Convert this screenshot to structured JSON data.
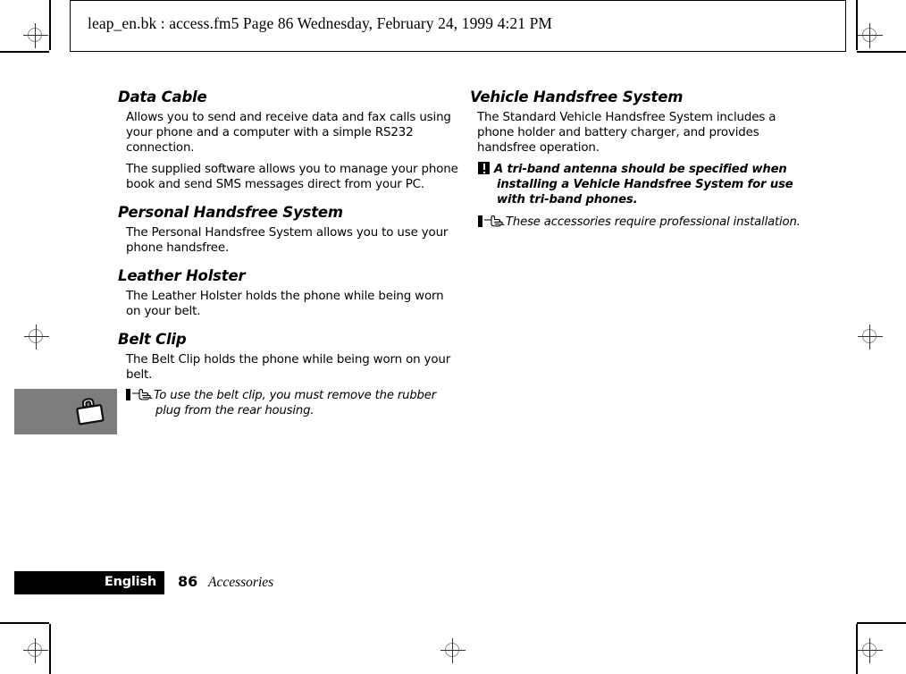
{
  "header": {
    "text": "leap_en.bk : access.fm5  Page 86  Wednesday, February 24, 1999  4:21 PM"
  },
  "left_column": {
    "sections": [
      {
        "heading": "Data Cable",
        "paragraphs": [
          "Allows you to send and receive data and fax calls using your phone and a computer with a simple RS232 connection.",
          "The supplied software allows you to manage your phone book and send SMS messages direct from your PC."
        ]
      },
      {
        "heading": "Personal Handsfree System",
        "paragraphs": [
          "The Personal Handsfree System allows you to use your phone handsfree."
        ]
      },
      {
        "heading": "Leather Holster",
        "paragraphs": [
          "The Leather Holster holds the phone while being worn on your belt."
        ]
      },
      {
        "heading": "Belt Clip",
        "paragraphs": [
          "The Belt Clip holds the phone while being worn on your belt."
        ],
        "note_hand": "To use the belt clip, you must remove the rubber plug from the rear housing."
      }
    ]
  },
  "right_column": {
    "sections": [
      {
        "heading": "Vehicle Handsfree System",
        "paragraphs": [
          "The Standard Vehicle Handsfree System includes a phone holder and battery charger, and provides handsfree operation."
        ],
        "note_warning": "A tri-band antenna should be specified when installing a Vehicle Handsfree System for use with tri-band phones.",
        "note_hand": "These accessories require professional installation."
      }
    ]
  },
  "thumb_tab": {
    "icon": "briefcase-icon",
    "color": "#7d7d7d"
  },
  "footer": {
    "language": "English",
    "page_number": "86",
    "section_title": "Accessories",
    "bar_color": "#000000"
  },
  "icons": {
    "note_hand": "pointing-hand-icon",
    "note_warning": "exclamation-warning-icon",
    "registration": "registration-mark-icon"
  }
}
